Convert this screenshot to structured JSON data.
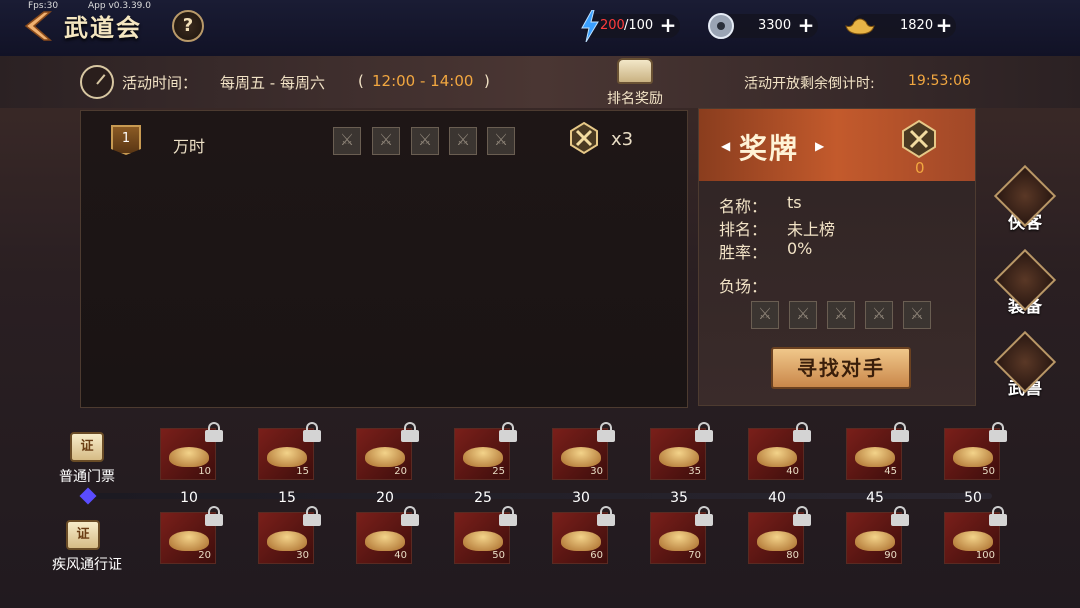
{
  "debug": {
    "fps": "Fps:30",
    "app_version": "App  v0.3.39.0"
  },
  "header": {
    "title": "武道会",
    "help_label": "?"
  },
  "resources": [
    {
      "name": "stamina",
      "icon": "lightning-icon",
      "current": "200",
      "sep": "/100"
    },
    {
      "name": "silver",
      "icon": "silver-coin-icon",
      "value": "3300"
    },
    {
      "name": "gold",
      "icon": "gold-ingot-icon",
      "value": "1820"
    }
  ],
  "activity": {
    "label": "活动时间：",
    "days": "每周五 - 每周六",
    "paren_open": "(",
    "time": "12:00 - 14:00",
    "paren_close": ")",
    "rank_reward_label": "排名奖励",
    "countdown_label": "活动开放剩余倒计时:",
    "countdown_value": "19:53:06"
  },
  "ranking": [
    {
      "rank": "1",
      "name": "万时",
      "medal_count": "x3"
    }
  ],
  "detail": {
    "title": "奖牌",
    "medal_count": "0",
    "name_label": "名称：",
    "name_value": "ts",
    "rank_label": "排名：",
    "rank_value": "未上榜",
    "winrate_label": "胜率：",
    "winrate_value": "0%",
    "losses_label": "负场：",
    "find_button": "寻找对手"
  },
  "side_buttons": [
    {
      "label": "侠客",
      "icon": "fox-icon"
    },
    {
      "label": "装备",
      "icon": "sword-icon"
    },
    {
      "label": "武兽",
      "icon": "paw-icon"
    }
  ],
  "rewards": {
    "ticket_label": "普通门票",
    "pass_label": "疾风通行证",
    "ticket_glyph": "证",
    "ticks": [
      "10",
      "15",
      "20",
      "25",
      "30",
      "35",
      "40",
      "45",
      "50"
    ],
    "row1": [
      "10",
      "15",
      "20",
      "25",
      "30",
      "35",
      "40",
      "45",
      "50"
    ],
    "row2": [
      "20",
      "30",
      "40",
      "50",
      "60",
      "70",
      "80",
      "90",
      "100"
    ]
  },
  "colors": {
    "accent": "#f2a740",
    "stamina_red": "#ff3b3b"
  }
}
